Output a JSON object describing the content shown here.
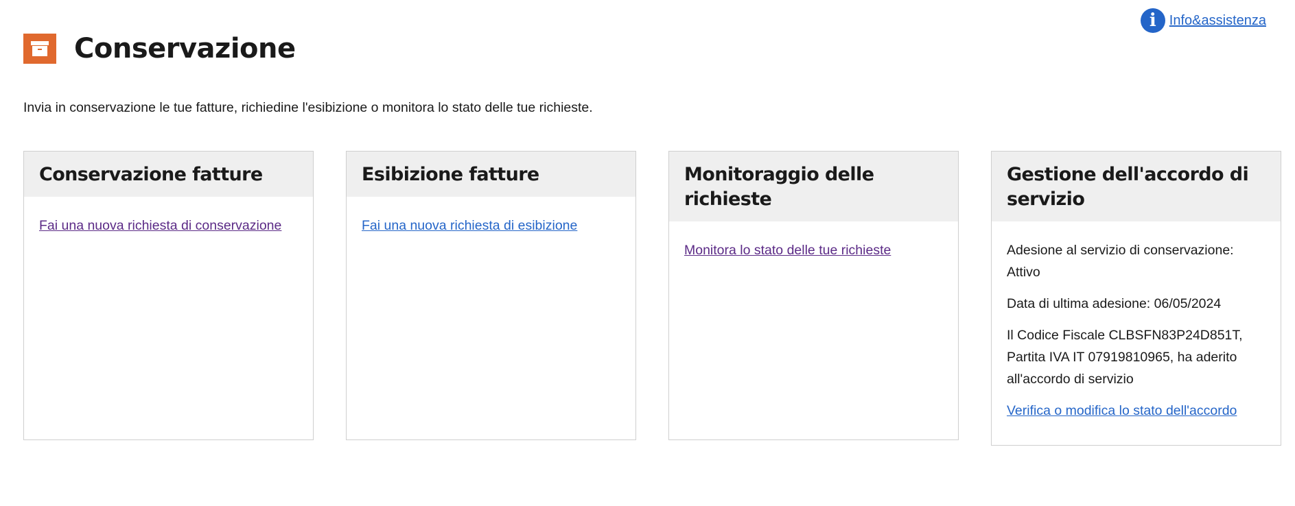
{
  "info": {
    "label": "Info&assistenza",
    "icon": "info-icon"
  },
  "header": {
    "title": "Conservazione",
    "icon": "archive-box-icon",
    "icon_color": "#e0692e"
  },
  "intro": "Invia in conservazione le tue fatture, richiedine l'esibizione o monitora lo stato delle tue richieste.",
  "cards": [
    {
      "title": "Conservazione fatture",
      "link": "Fai una nuova richiesta di conservazione"
    },
    {
      "title": "Esibizione fatture",
      "link": "Fai una nuova richiesta di esibizione"
    },
    {
      "title": "Monitoraggio delle richieste",
      "link": "Monitora lo stato delle tue richieste"
    },
    {
      "title": "Gestione dell'accordo di servizio",
      "status": "Adesione al servizio di conservazione: Attivo",
      "date": "Data di ultima adesione: 06/05/2024",
      "fiscal": "Il Codice Fiscale CLBSFN83P24D851T, Partita IVA IT 07919810965, ha aderito all'accordo di servizio",
      "link": "Verifica o modifica lo stato dell'accordo"
    }
  ],
  "colors": {
    "link": "#2465c8",
    "visited_link": "#5b2a86",
    "card_header_bg": "#efefef"
  }
}
